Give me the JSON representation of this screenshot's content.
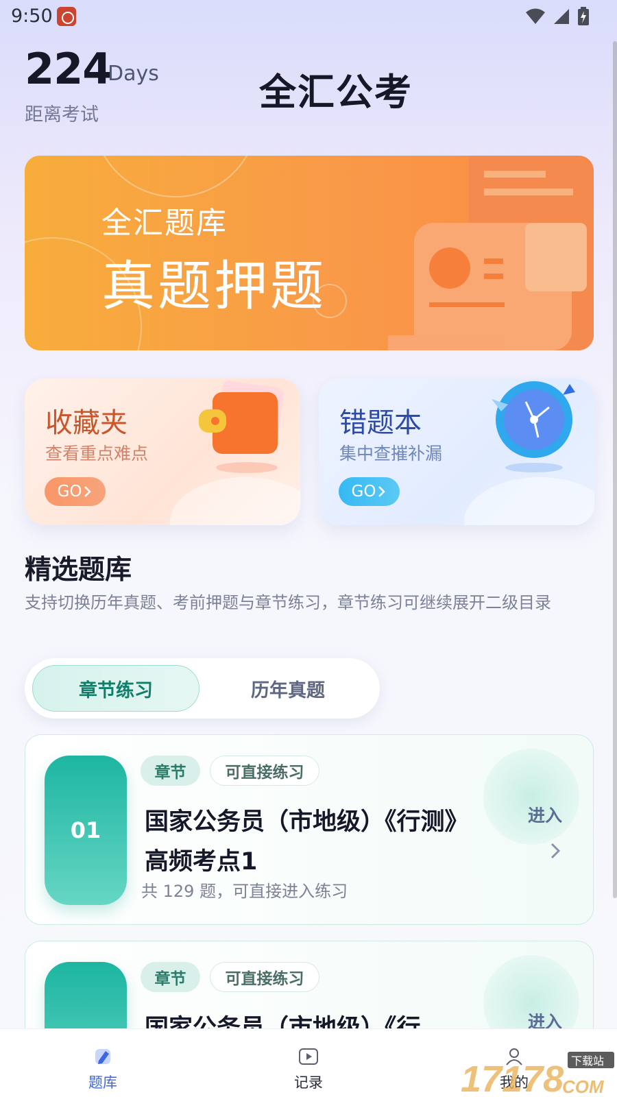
{
  "status_bar": {
    "time": "9:50"
  },
  "header": {
    "days_count": "224",
    "days_unit": "Days",
    "days_caption": "距离考试",
    "app_title": "全汇公考"
  },
  "banner": {
    "subtitle": "全汇题库",
    "title": "真题押题"
  },
  "quick_cards": [
    {
      "title": "收藏夹",
      "desc": "查看重点难点",
      "button": "GO"
    },
    {
      "title": "错题本",
      "desc": "集中查摧补漏",
      "button": "GO"
    }
  ],
  "section": {
    "title": "精选题库",
    "desc": "支持切换历年真题、考前押题与章节练习，章节练习可继续展开二级目录"
  },
  "tabs": [
    {
      "label": "章节练习",
      "active": true
    },
    {
      "label": "历年真题",
      "active": false
    }
  ],
  "cards": [
    {
      "num": "01",
      "chip_chapter": "章节",
      "chip_direct": "可直接练习",
      "title": "国家公务员（市地级）《行测》高频考点1",
      "sub": "共 129 题，可直接进入练习",
      "enter": "进入"
    },
    {
      "num": "",
      "chip_chapter": "章节",
      "chip_direct": "可直接练习",
      "title": "国家公务员（市地级）《行",
      "sub": "",
      "enter": "进入"
    }
  ],
  "bottom_nav": [
    {
      "label": "题库",
      "icon": "pen-icon",
      "active": true
    },
    {
      "label": "记录",
      "icon": "play-icon",
      "active": false
    },
    {
      "label": "我的",
      "icon": "user-icon",
      "active": false
    }
  ],
  "watermark": {
    "text": "17178",
    "sub": "下载站",
    "domain": "COM"
  },
  "colors": {
    "accent": "#3b67e0",
    "brand_teal": "#1db6a2",
    "banner_orange": "#f99a48"
  }
}
